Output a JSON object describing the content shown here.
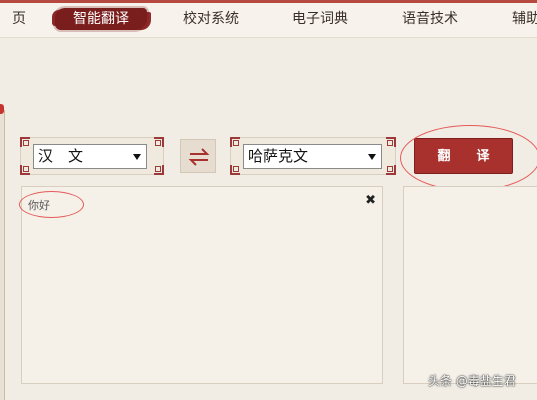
{
  "nav": {
    "items": [
      {
        "label": "首　页"
      },
      {
        "label": "智能翻译"
      },
      {
        "label": "校对系统"
      },
      {
        "label": "电子词典"
      },
      {
        "label": "语音技术"
      },
      {
        "label": "辅助"
      }
    ],
    "active_index": 1
  },
  "translator": {
    "source_language": "汉　文",
    "target_language": "哈萨克文",
    "translate_label": "翻　　译",
    "input_text": "你好",
    "output_text": ""
  },
  "watermark": "头条 @毒盐生君",
  "colors": {
    "accent": "#a8312e",
    "nav_active": "#7a1d1d",
    "annotation": "#e55a5a"
  }
}
